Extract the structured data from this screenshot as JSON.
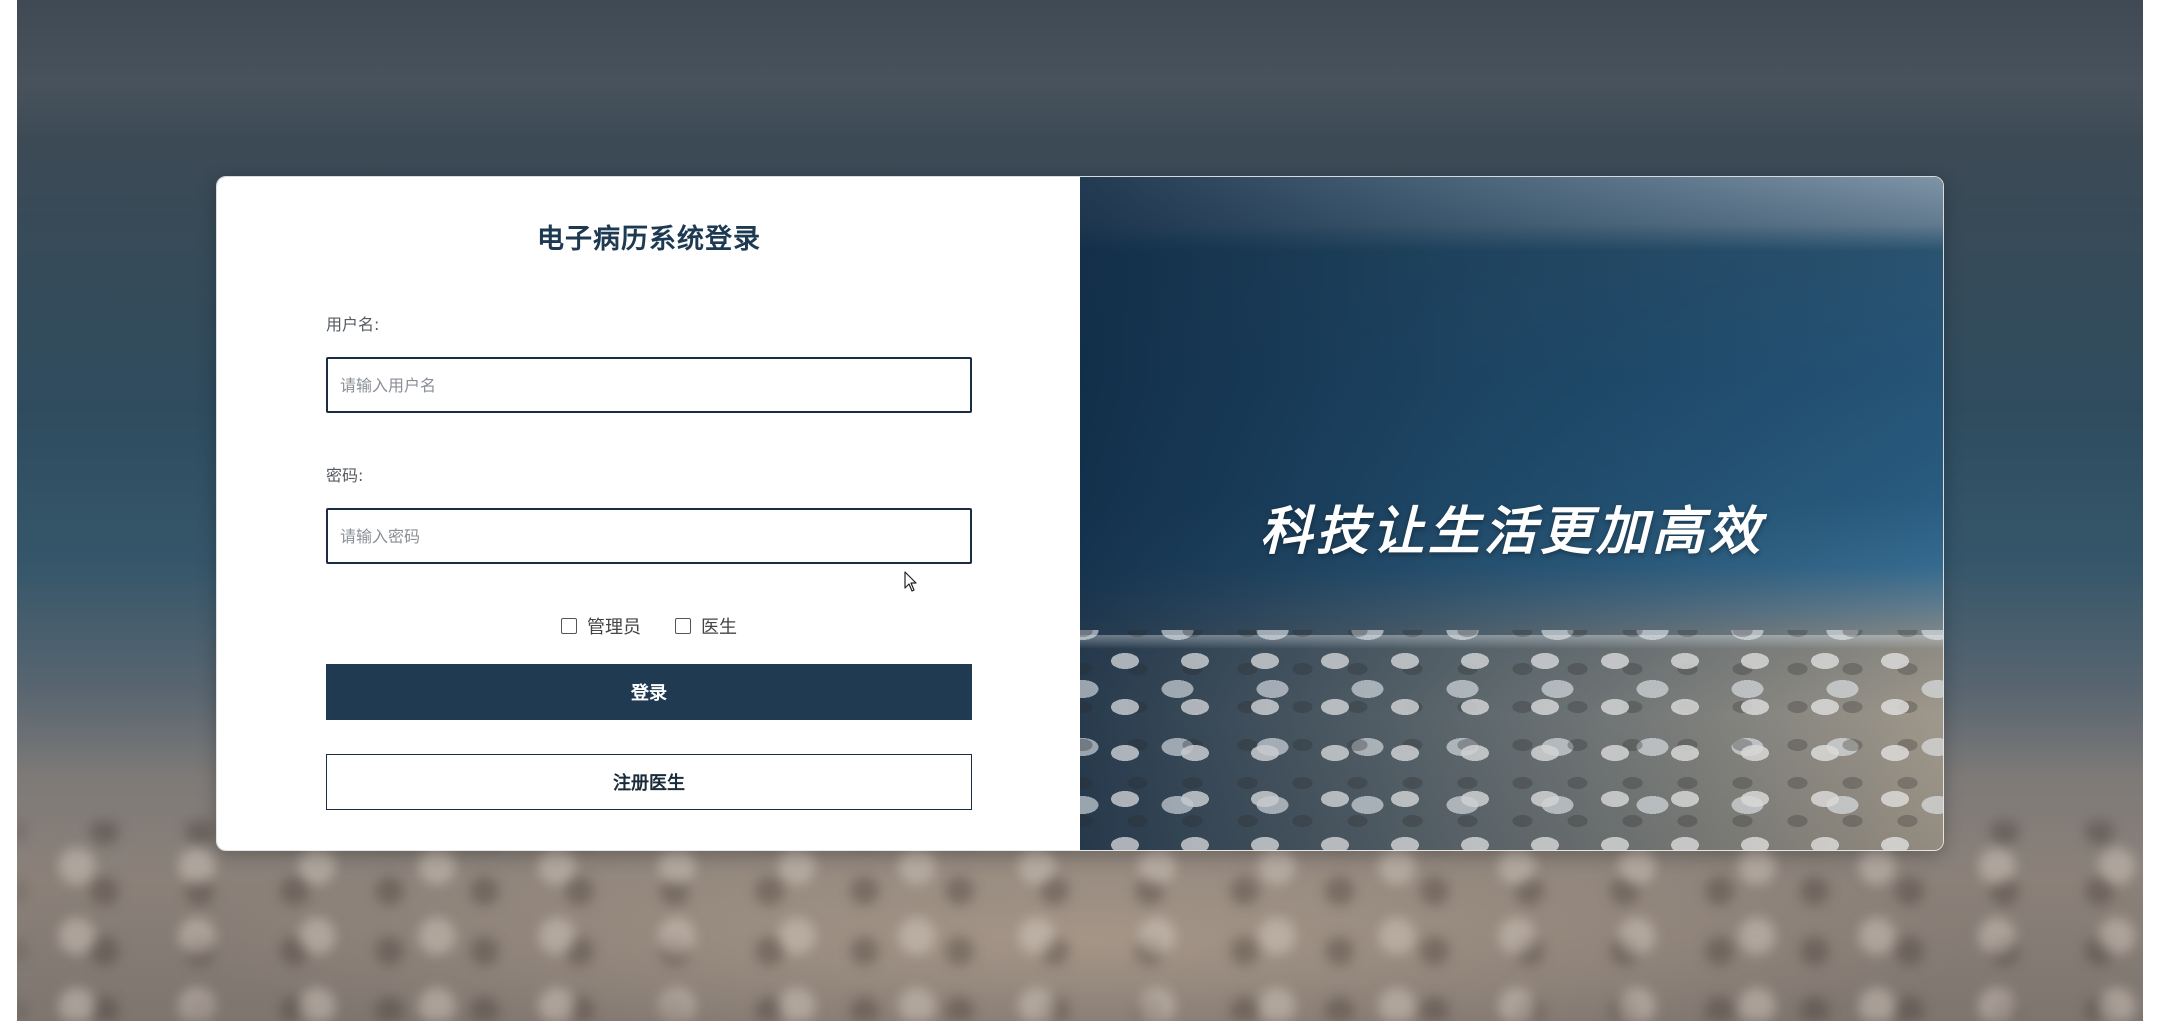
{
  "login": {
    "title": "电子病历系统登录",
    "username_label": "用户名:",
    "username_placeholder": "请输入用户名",
    "password_label": "密码:",
    "password_placeholder": "请输入密码",
    "roles": [
      {
        "label": "管理员",
        "checked": false
      },
      {
        "label": "医生",
        "checked": false
      }
    ],
    "login_button": "登录",
    "register_button": "注册医生"
  },
  "banner": {
    "slogan": "科技让生活更加高效"
  },
  "colors": {
    "primary": "#1f3a51",
    "title": "#1e3a52",
    "input_border": "#1b2d44"
  }
}
